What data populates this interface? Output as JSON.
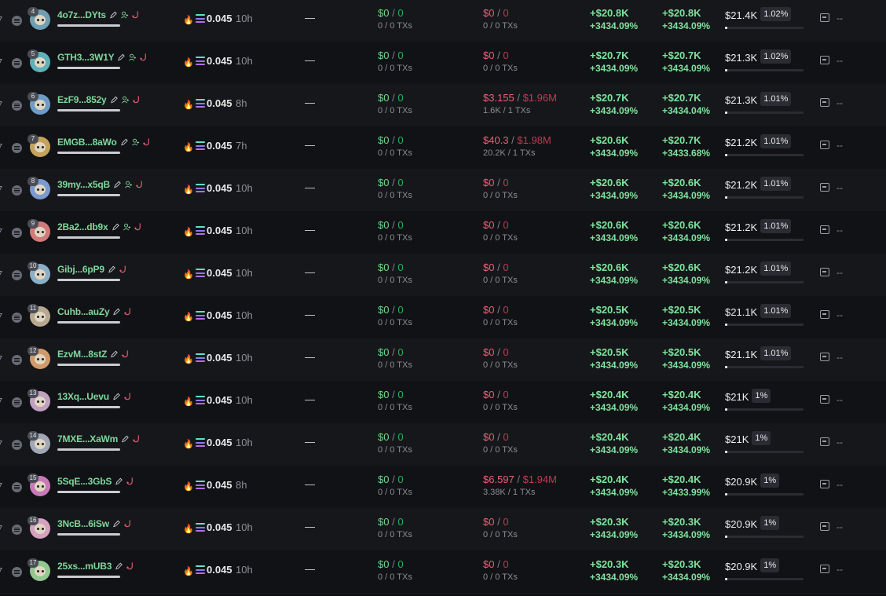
{
  "colors": {
    "positive": "#7fe39c",
    "negative": "#ea6077",
    "name": "#7fd79c",
    "background": "#101114"
  },
  "row_height": 54,
  "rows": [
    {
      "rank": "4",
      "name": "4o7z...DYts",
      "sol": "0.045",
      "age": "10h",
      "dash": "—",
      "bought_usd": "$0",
      "bought_sol": "0",
      "bought_sub": "0 / 0 TXs",
      "sold_usd": "$0",
      "sold_sol": "0",
      "sold_sub": "0 / 0 TXs",
      "unrealized": "+$20.8K",
      "unrealized_pct": "+3434.09%",
      "total_pnl": "+$20.8K",
      "total_pnl_pct": "+3434.09%",
      "holding": "$21.4K",
      "holding_pct": "1.02%",
      "last": "--",
      "icon_user": true,
      "avatar_color": "#6f9fb4"
    },
    {
      "rank": "5",
      "name": "GTH3...3W1Y",
      "sol": "0.045",
      "age": "10h",
      "dash": "—",
      "bought_usd": "$0",
      "bought_sol": "0",
      "bought_sub": "0 / 0 TXs",
      "sold_usd": "$0",
      "sold_sol": "0",
      "sold_sub": "0 / 0 TXs",
      "unrealized": "+$20.7K",
      "unrealized_pct": "+3434.09%",
      "total_pnl": "+$20.7K",
      "total_pnl_pct": "+3434.09%",
      "holding": "$21.3K",
      "holding_pct": "1.02%",
      "last": "--",
      "icon_user": true,
      "avatar_color": "#5fb0b8"
    },
    {
      "rank": "6",
      "name": "EzF9...852y",
      "sol": "0.045",
      "age": "8h",
      "dash": "—",
      "bought_usd": "$0",
      "bought_sol": "0",
      "bought_sub": "0 / 0 TXs",
      "sold_usd": "$3.155",
      "sold_sol": "$1.96M",
      "sold_sub": "1.6K / 1 TXs",
      "unrealized": "+$20.7K",
      "unrealized_pct": "+3434.09%",
      "total_pnl": "+$20.7K",
      "total_pnl_pct": "+3434.04%",
      "holding": "$21.3K",
      "holding_pct": "1.01%",
      "last": "--",
      "icon_user": true,
      "avatar_color": "#6e9cc8"
    },
    {
      "rank": "7",
      "name": "EMGB...8aWo",
      "sol": "0.045",
      "age": "7h",
      "dash": "—",
      "bought_usd": "$0",
      "bought_sol": "0",
      "bought_sub": "0 / 0 TXs",
      "sold_usd": "$40.3",
      "sold_sol": "$1.98M",
      "sold_sub": "20.2K / 1 TXs",
      "unrealized": "+$20.6K",
      "unrealized_pct": "+3434.09%",
      "total_pnl": "+$20.7K",
      "total_pnl_pct": "+3433.68%",
      "holding": "$21.2K",
      "holding_pct": "1.01%",
      "last": "--",
      "icon_user": true,
      "avatar_color": "#c4a25a"
    },
    {
      "rank": "8",
      "name": "39my...x5qB",
      "sol": "0.045",
      "age": "10h",
      "dash": "—",
      "bought_usd": "$0",
      "bought_sol": "0",
      "bought_sub": "0 / 0 TXs",
      "sold_usd": "$0",
      "sold_sol": "0",
      "sold_sub": "0 / 0 TXs",
      "unrealized": "+$20.6K",
      "unrealized_pct": "+3434.09%",
      "total_pnl": "+$20.6K",
      "total_pnl_pct": "+3434.09%",
      "holding": "$21.2K",
      "holding_pct": "1.01%",
      "last": "--",
      "icon_user": true,
      "avatar_color": "#7a9ad0"
    },
    {
      "rank": "9",
      "name": "2Ba2...db9x",
      "sol": "0.045",
      "age": "10h",
      "dash": "—",
      "bought_usd": "$0",
      "bought_sol": "0",
      "bought_sub": "0 / 0 TXs",
      "sold_usd": "$0",
      "sold_sol": "0",
      "sold_sub": "0 / 0 TXs",
      "unrealized": "+$20.6K",
      "unrealized_pct": "+3434.09%",
      "total_pnl": "+$20.6K",
      "total_pnl_pct": "+3434.09%",
      "holding": "$21.2K",
      "holding_pct": "1.01%",
      "last": "--",
      "icon_user": true,
      "avatar_color": "#d07a7a"
    },
    {
      "rank": "10",
      "name": "Gibj...6pP9",
      "sol": "0.045",
      "age": "10h",
      "dash": "—",
      "bought_usd": "$0",
      "bought_sol": "0",
      "bought_sub": "0 / 0 TXs",
      "sold_usd": "$0",
      "sold_sol": "0",
      "sold_sub": "0 / 0 TXs",
      "unrealized": "+$20.6K",
      "unrealized_pct": "+3434.09%",
      "total_pnl": "+$20.6K",
      "total_pnl_pct": "+3434.09%",
      "holding": "$21.2K",
      "holding_pct": "1.01%",
      "last": "--",
      "icon_user": false,
      "avatar_color": "#8ab0c8"
    },
    {
      "rank": "11",
      "name": "Cuhb...auZy",
      "sol": "0.045",
      "age": "10h",
      "dash": "—",
      "bought_usd": "$0",
      "bought_sol": "0",
      "bought_sub": "0 / 0 TXs",
      "sold_usd": "$0",
      "sold_sol": "0",
      "sold_sub": "0 / 0 TXs",
      "unrealized": "+$20.5K",
      "unrealized_pct": "+3434.09%",
      "total_pnl": "+$20.5K",
      "total_pnl_pct": "+3434.09%",
      "holding": "$21.1K",
      "holding_pct": "1.01%",
      "last": "--",
      "icon_user": false,
      "avatar_color": "#b8a890"
    },
    {
      "rank": "12",
      "name": "EzvM...8stZ",
      "sol": "0.045",
      "age": "10h",
      "dash": "—",
      "bought_usd": "$0",
      "bought_sol": "0",
      "bought_sub": "0 / 0 TXs",
      "sold_usd": "$0",
      "sold_sol": "0",
      "sold_sub": "0 / 0 TXs",
      "unrealized": "+$20.5K",
      "unrealized_pct": "+3434.09%",
      "total_pnl": "+$20.5K",
      "total_pnl_pct": "+3434.09%",
      "holding": "$21.1K",
      "holding_pct": "1.01%",
      "last": "--",
      "icon_user": false,
      "avatar_color": "#d09a6a"
    },
    {
      "rank": "13",
      "name": "13Xq...Uevu",
      "sol": "0.045",
      "age": "10h",
      "dash": "—",
      "bought_usd": "$0",
      "bought_sol": "0",
      "bought_sub": "0 / 0 TXs",
      "sold_usd": "$0",
      "sold_sol": "0",
      "sold_sub": "0 / 0 TXs",
      "unrealized": "+$20.4K",
      "unrealized_pct": "+3434.09%",
      "total_pnl": "+$20.4K",
      "total_pnl_pct": "+3434.09%",
      "holding": "$21K",
      "holding_pct": "1%",
      "last": "--",
      "icon_user": false,
      "avatar_color": "#c0a0c0"
    },
    {
      "rank": "14",
      "name": "7MXE...XaWm",
      "sol": "0.045",
      "age": "10h",
      "dash": "—",
      "bought_usd": "$0",
      "bought_sol": "0",
      "bought_sub": "0 / 0 TXs",
      "sold_usd": "$0",
      "sold_sol": "0",
      "sold_sub": "0 / 0 TXs",
      "unrealized": "+$20.4K",
      "unrealized_pct": "+3434.09%",
      "total_pnl": "+$20.4K",
      "total_pnl_pct": "+3434.09%",
      "holding": "$21K",
      "holding_pct": "1%",
      "last": "--",
      "icon_user": false,
      "avatar_color": "#a0a8b8"
    },
    {
      "rank": "15",
      "name": "5SqE...3GbS",
      "sol": "0.045",
      "age": "8h",
      "dash": "—",
      "bought_usd": "$0",
      "bought_sol": "0",
      "bought_sub": "0 / 0 TXs",
      "sold_usd": "$6.597",
      "sold_sol": "$1.94M",
      "sold_sub": "3.38K / 1 TXs",
      "unrealized": "+$20.4K",
      "unrealized_pct": "+3434.09%",
      "total_pnl": "+$20.4K",
      "total_pnl_pct": "+3433.99%",
      "holding": "$20.9K",
      "holding_pct": "1%",
      "last": "--",
      "icon_user": false,
      "avatar_color": "#c87ab8"
    },
    {
      "rank": "16",
      "name": "3NcB...6iSw",
      "sol": "0.045",
      "age": "10h",
      "dash": "—",
      "bought_usd": "$0",
      "bought_sol": "0",
      "bought_sub": "0 / 0 TXs",
      "sold_usd": "$0",
      "sold_sol": "0",
      "sold_sub": "0 / 0 TXs",
      "unrealized": "+$20.3K",
      "unrealized_pct": "+3434.09%",
      "total_pnl": "+$20.3K",
      "total_pnl_pct": "+3434.09%",
      "holding": "$20.9K",
      "holding_pct": "1%",
      "last": "--",
      "icon_user": false,
      "avatar_color": "#d8a0c0"
    },
    {
      "rank": "17",
      "name": "25xs...mUB3",
      "sol": "0.045",
      "age": "10h",
      "dash": "—",
      "bought_usd": "$0",
      "bought_sol": "0",
      "bought_sub": "0 / 0 TXs",
      "sold_usd": "$0",
      "sold_sol": "0",
      "sold_sub": "0 / 0 TXs",
      "unrealized": "+$20.3K",
      "unrealized_pct": "+3434.09%",
      "total_pnl": "+$20.3K",
      "total_pnl_pct": "+3434.09%",
      "holding": "$20.9K",
      "holding_pct": "1%",
      "last": "--",
      "icon_user": false,
      "avatar_color": "#90c890"
    }
  ]
}
